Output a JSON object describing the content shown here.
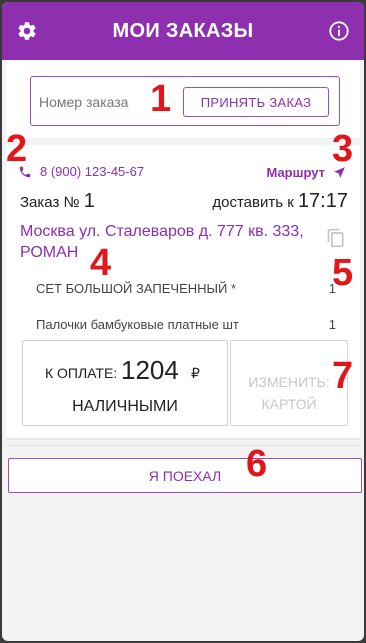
{
  "header": {
    "title": "МОИ ЗАКАЗЫ",
    "left_icon": "gear-icon",
    "right_icon": "info-icon",
    "color": "#8e2fb0"
  },
  "order_entry": {
    "placeholder": "Номер заказа",
    "accept_label": "ПРИНЯТЬ ЗАКАЗ"
  },
  "order": {
    "phone": "8 (900) 123-45-67",
    "route_label": "Маршрут",
    "number_prefix": "Заказ №",
    "number": "1",
    "deliver_prefix": "доставить к",
    "deliver_time": "17:17",
    "address": "Москва ул. Сталеваров д. 777 кв. 333, РОМАН",
    "items": [
      {
        "name": "СЕТ БОЛЬШОЙ ЗАПЕЧЕННЫЙ *",
        "qty": "1"
      },
      {
        "name": "Палочки бамбуковые платные шт",
        "qty": "1"
      }
    ],
    "payment": {
      "label": "К ОПЛАТЕ:",
      "amount": "1204",
      "currency": "₽",
      "method": "НАЛИЧНЫМИ"
    },
    "change_label_line1": "ИЗМЕНИТЬ:",
    "change_label_line2": "КАРТОЙ"
  },
  "go_label": "Я ПОЕХАЛ",
  "markers": [
    "1",
    "2",
    "3",
    "4",
    "5",
    "6",
    "7"
  ],
  "marker_color": "#e2151b"
}
